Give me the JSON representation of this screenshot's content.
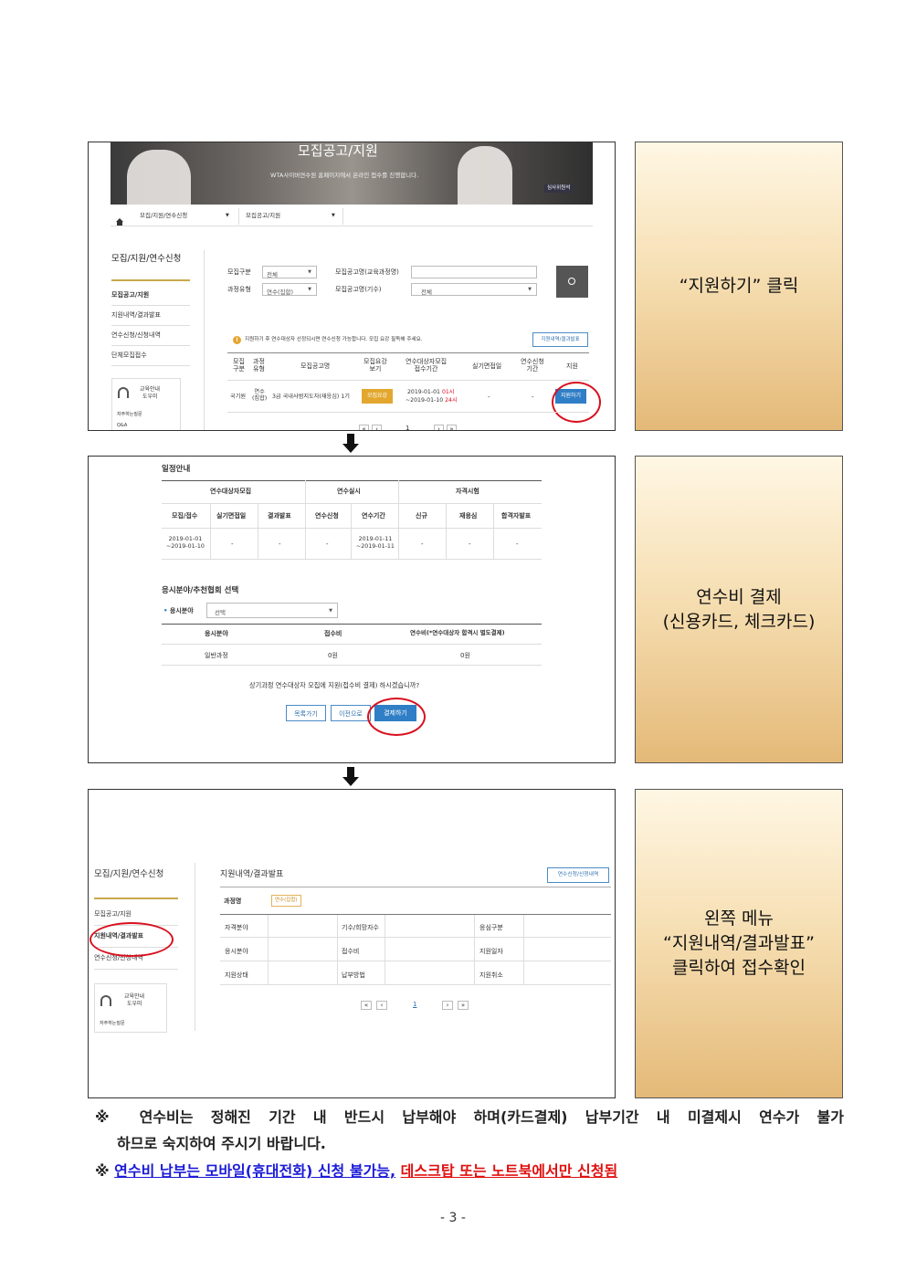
{
  "panel1": {
    "banner_title": "모집공고/지원",
    "banner_sub": "WTA사이버연수원 홈페이지에서 온라인 접수를 진행합니다.",
    "banner_badge": "심사위원석",
    "breadcrumb": {
      "home_icon": "home-icon",
      "level1": "모집/지원/연수신청",
      "level2": "모집공고/지원"
    },
    "sidebar": {
      "title": "모집/지원/연수신청",
      "items": [
        "모집공고/지원",
        "지원내역/결과발표",
        "연수신청/신청내역",
        "단체모집접수"
      ],
      "help_line1": "교육안내",
      "help_line2": "도우미",
      "faq": "자주하는질문",
      "qna": "Q&A"
    },
    "search": {
      "label_category": "모집구분",
      "category_value": "전체",
      "label_notice_course": "모집공고명(교육과정명)",
      "label_type": "과정유형",
      "type_value": "연수(집합)",
      "label_notice_round": "모집공고명(기수)",
      "round_value": "전체"
    },
    "info_text": "지원하기 후 연수대상자 선정되시면 연수신청 가능합니다. 모집 요강 필독해 주세요.",
    "history_button": "지원내역/결과발표",
    "table": {
      "headers": [
        "모집\n구분",
        "과정\n유형",
        "모집공고명",
        "모집요강\n보기",
        "연수대상자모집\n접수기간",
        "실기면접일",
        "연수신청\n기간",
        "지원"
      ],
      "row": {
        "category": "국기원",
        "type": "연수\n(집합)",
        "name": "3급 국내사범지도자(재응심) 1기",
        "guide_button": "모집요강",
        "period_start": "2019-01-01",
        "period_start_hour": "01시",
        "period_end": "~2019-01-10",
        "period_end_hour": "24시",
        "interview": "-",
        "apply_period": "-",
        "apply_button": "지원하기"
      }
    },
    "pager": [
      "«",
      "‹",
      "1",
      "›",
      "»"
    ]
  },
  "caption1": "“지원하기” 클릭",
  "panel2": {
    "schedule_title": "일정안내",
    "groups": [
      "연수대상자모집",
      "연수실시",
      "자격시험"
    ],
    "headers": [
      "모집/접수",
      "실기면접일",
      "결과발표",
      "연수신청",
      "연수기간",
      "신규",
      "재응심",
      "합격자발표"
    ],
    "row": [
      "2019-01-01\n~2019-01-10",
      "-",
      "-",
      "-",
      "2019-01-11\n~2019-01-11",
      "-",
      "-",
      "-"
    ],
    "field_title": "응시분야/추천협회 선택",
    "field_label": "응시분야",
    "field_select": "선택",
    "fee_headers": [
      "응시분야",
      "접수비",
      "연수비(*연수대상자 합격시 별도결제)"
    ],
    "fee_row": [
      "일반과정",
      "0원",
      "0원"
    ],
    "confirm_question": "상기과정 연수대상자 모집에 지원(접수비 결제) 하시겠습니까?",
    "buttons": [
      "목록가기",
      "이전으로",
      "결제하기"
    ]
  },
  "caption2_line1": "연수비  결제",
  "caption2_line2": "(신용카드,  체크카드)",
  "panel3": {
    "sidebar_title": "모집/지원/연수신청",
    "sidebar_items": [
      "모집공고/지원",
      "지원내역/결과발표",
      "연수신청/신청내역"
    ],
    "help_line1": "교육안내",
    "help_line2": "도우미",
    "faq": "자주하는질문",
    "title": "지원내역/결과발표",
    "top_button": "연수신청/신청내역",
    "course_label": "과정명",
    "course_badge": "연수(집합)",
    "rows": [
      [
        "자격분야",
        "기수/희망자수",
        "응심구분"
      ],
      [
        "응시분야",
        "접수비",
        "지원일자"
      ],
      [
        "지원상태",
        "납부방법",
        "지원취소"
      ]
    ],
    "pager": [
      "«",
      "‹",
      "1",
      "›",
      "»"
    ]
  },
  "caption3_line1": "왼쪽  메뉴",
  "caption3_line2": "“지원내역/결과발표”",
  "caption3_line3": "클릭하여  접수확인",
  "notes": {
    "mark": "※",
    "line1": "연수비는 정해진 기간 내 반드시 납부해야 하며(카드결제) 납부기간 내 미결제시 연수가 불가",
    "line1b": "하므로 숙지하여 주시기 바랍니다.",
    "line2_blue": "연수비 납부는 모바일(휴대전화) 신청 불가능,",
    "line2_red": "데스크탑 또는 노트북에서만 신청됨"
  },
  "page_number": "- 3 -",
  "colors": {
    "highlight_red": "#d8101e",
    "apply_blue": "#2f7ec6",
    "guide_gold": "#e3a72f",
    "note_blue": "#1a1ad8",
    "note_red": "#e01010"
  }
}
